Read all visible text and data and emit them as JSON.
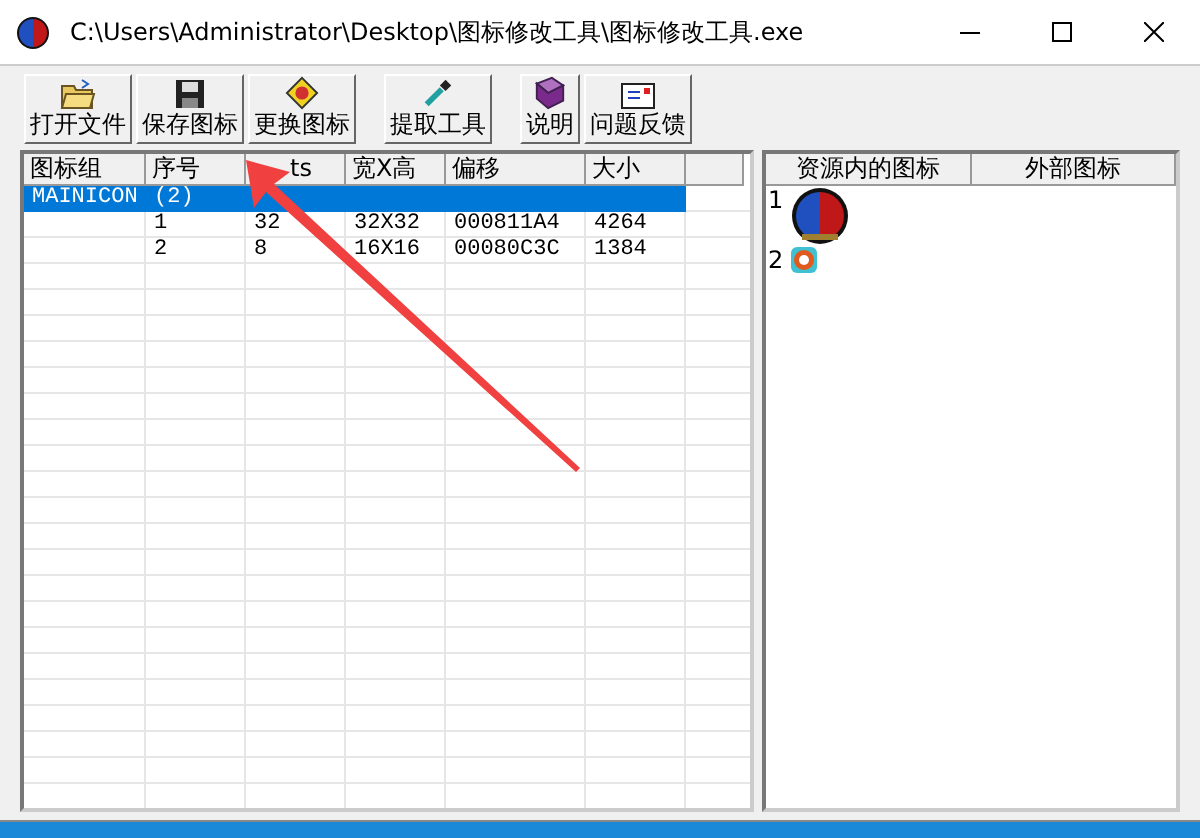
{
  "window": {
    "title": "C:\\Users\\Administrator\\Desktop\\图标修改工具\\图标修改工具.exe"
  },
  "toolbar": [
    {
      "label": "打开文件",
      "kind": "open"
    },
    {
      "label": "保存图标",
      "kind": "save"
    },
    {
      "label": "更换图标",
      "kind": "replace"
    },
    {
      "label": "提取工具",
      "kind": "extract"
    },
    {
      "label": "说明",
      "kind": "help"
    },
    {
      "label": "问题反馈",
      "kind": "feedback"
    }
  ],
  "table": {
    "columns": [
      "图标组",
      "序号",
      "ts",
      "宽X高",
      "偏移",
      "大小"
    ],
    "rows": [
      {
        "cells": [
          "MAINICON",
          "(2)",
          "",
          "",
          "",
          ""
        ],
        "selected": true
      },
      {
        "cells": [
          "",
          "1",
          "32",
          "32X32",
          "000811A4",
          "4264"
        ],
        "selected": false
      },
      {
        "cells": [
          "",
          "2",
          "8",
          "16X16",
          "00080C3C",
          "1384"
        ],
        "selected": false
      }
    ]
  },
  "icon_panel": {
    "columns": [
      "资源内的图标",
      "外部图标"
    ],
    "items": [
      {
        "index": "1",
        "kind": "large"
      },
      {
        "index": "2",
        "kind": "small"
      }
    ]
  }
}
